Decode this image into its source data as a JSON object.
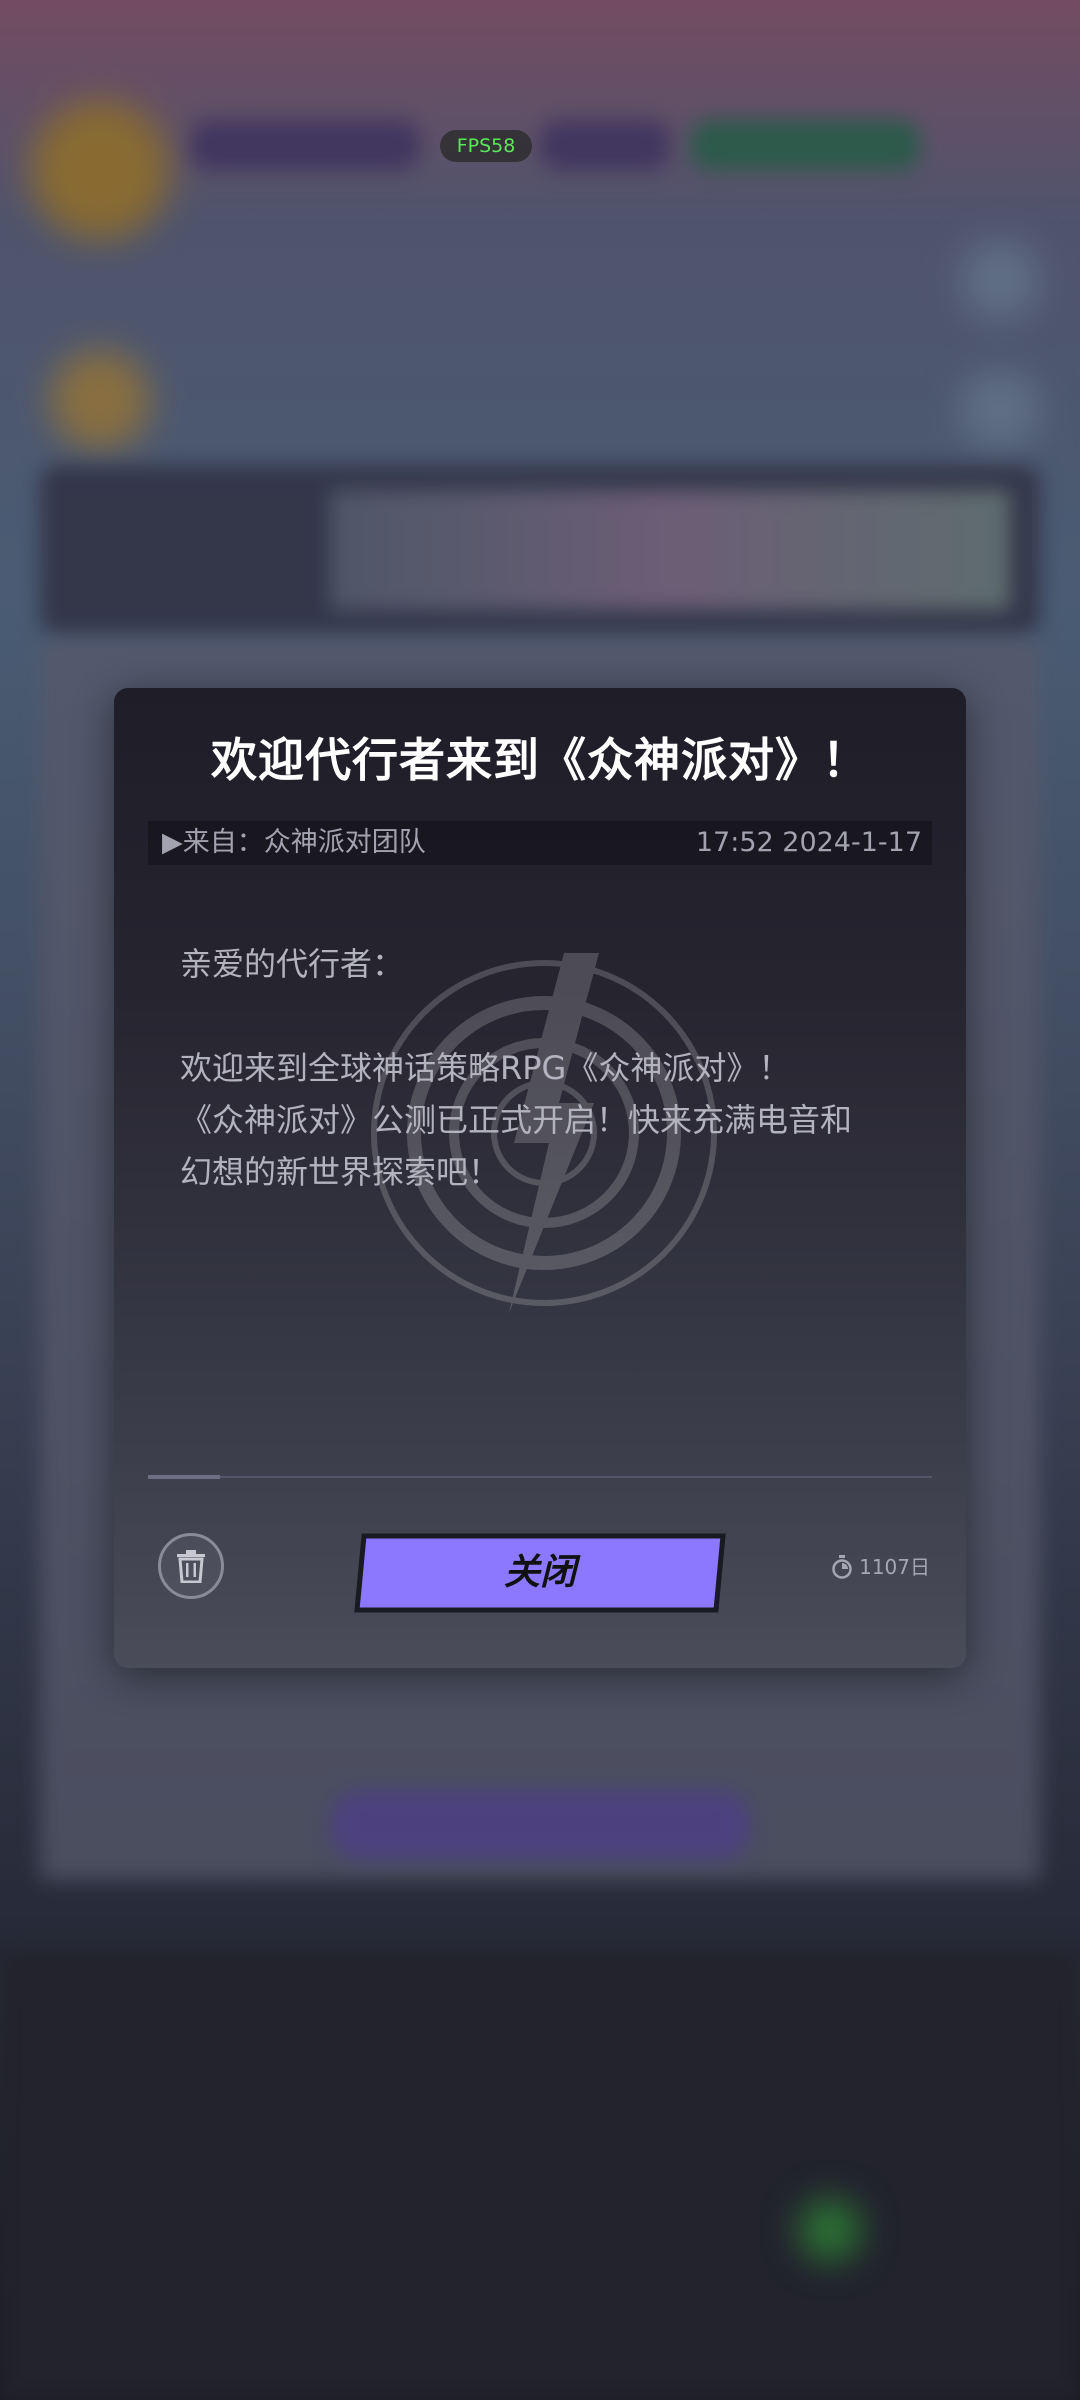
{
  "hud": {
    "fps_label": "FPS58"
  },
  "mail": {
    "title": "欢迎代行者来到《众神派对》！",
    "from": "▶来自：众神派对团队",
    "timestamp": "17:52 2024-1-17",
    "greeting": "亲爱的代行者：",
    "body_lines": [
      "欢迎来到全球神话策略RPG《众神派对》！",
      "《众神派对》公测已正式开启！快来充满电音和",
      "幻想的新世界探索吧！"
    ],
    "close_label": "关闭",
    "expire_label": "1107日",
    "icons": {
      "delete": "trash-icon",
      "timer": "stopwatch-icon",
      "watermark": "lightning-emblem-icon"
    },
    "colors": {
      "button": "#8c78ff",
      "panel": "#26242f",
      "fps": "#5ce65c"
    }
  }
}
